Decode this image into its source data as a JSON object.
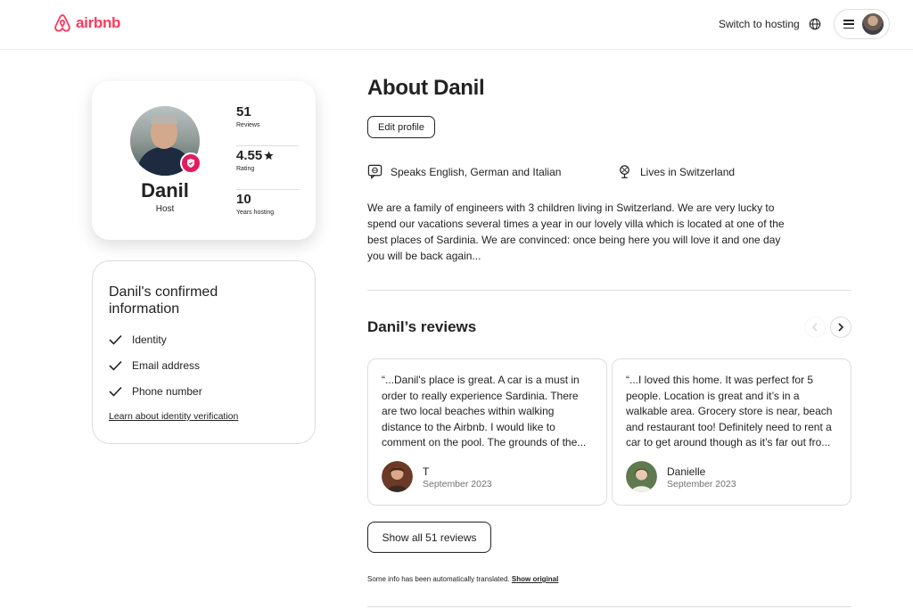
{
  "header": {
    "logo_text": "airbnb",
    "switch_hosting": "Switch to hosting",
    "globe_icon": "globe-icon",
    "menu_icon": "hamburger-icon",
    "brand_color": "#ff385c"
  },
  "profile": {
    "name": "Danil",
    "role": "Host",
    "stats": [
      {
        "value": "51",
        "label": "Reviews"
      },
      {
        "value": "4.55",
        "label": "Rating"
      },
      {
        "value": "10",
        "label": "Years hosting"
      }
    ]
  },
  "confirmed": {
    "title": "Danil's confirmed information",
    "items": [
      "Identity",
      "Email address",
      "Phone number"
    ],
    "link": "Learn about identity verification"
  },
  "about": {
    "title": "About Danil",
    "edit_button": "Edit profile",
    "speaks": "Speaks English, German and Italian",
    "lives": "Lives in Switzerland",
    "bio": "We are a family of engineers with 3 children living in Switzerland. We are very lucky to spend our vacations several times a year in our lovely villa which is located at one of the best places of Sardinia. We are convinced: once being here you will love it and one day you will be back again..."
  },
  "reviews": {
    "title": "Danil’s reviews",
    "items": [
      {
        "text": "“...Danil's place is great. A car is a must in order to really experience Sardinia. There are two local beaches within walking distance to the Airbnb. I would like to comment on the pool. The grounds of the...",
        "name": "T",
        "date": "September 2023"
      },
      {
        "text": "“...I loved this home. It was perfect for 5 people. Location is great and it’s in a walkable area. Grocery store is near, beach and restaurant too! Definitely need to rent a car to get around though as it’s far out fro...",
        "name": "Danielle",
        "date": "September 2023"
      }
    ],
    "show_all": "Show all 51 reviews"
  },
  "footer_note": {
    "text": "Some info has been automatically translated.",
    "link": "Show original"
  }
}
